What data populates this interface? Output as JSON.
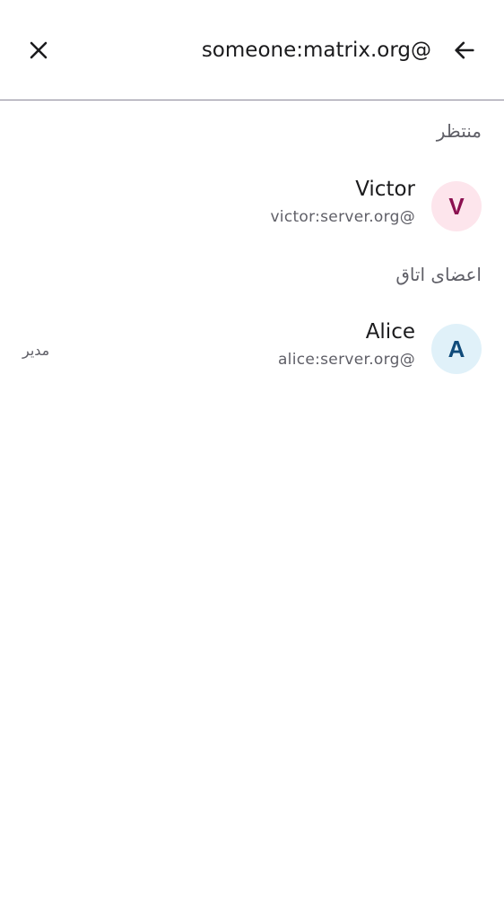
{
  "search": {
    "query": "someone:matrix.org@",
    "back_icon": "arrow-back-icon",
    "clear_icon": "close-icon"
  },
  "sections": {
    "pending": {
      "title": "منتظر",
      "members": [
        {
          "initial": "V",
          "name": "Victor",
          "user_id": "victor:server.org@",
          "avatar_bg": "#fde5ec",
          "avatar_fg": "#8b1050",
          "role": ""
        }
      ]
    },
    "room_members": {
      "title": "اعضای اتاق",
      "members": [
        {
          "initial": "A",
          "name": "Alice",
          "user_id": "alice:server.org@",
          "avatar_bg": "#e0f1f9",
          "avatar_fg": "#104b7a",
          "role": "مدیر"
        }
      ]
    }
  },
  "colors": {
    "divider": "#8a8797",
    "primary_text": "#1b1b1d",
    "secondary_text": "#5f5f67"
  }
}
